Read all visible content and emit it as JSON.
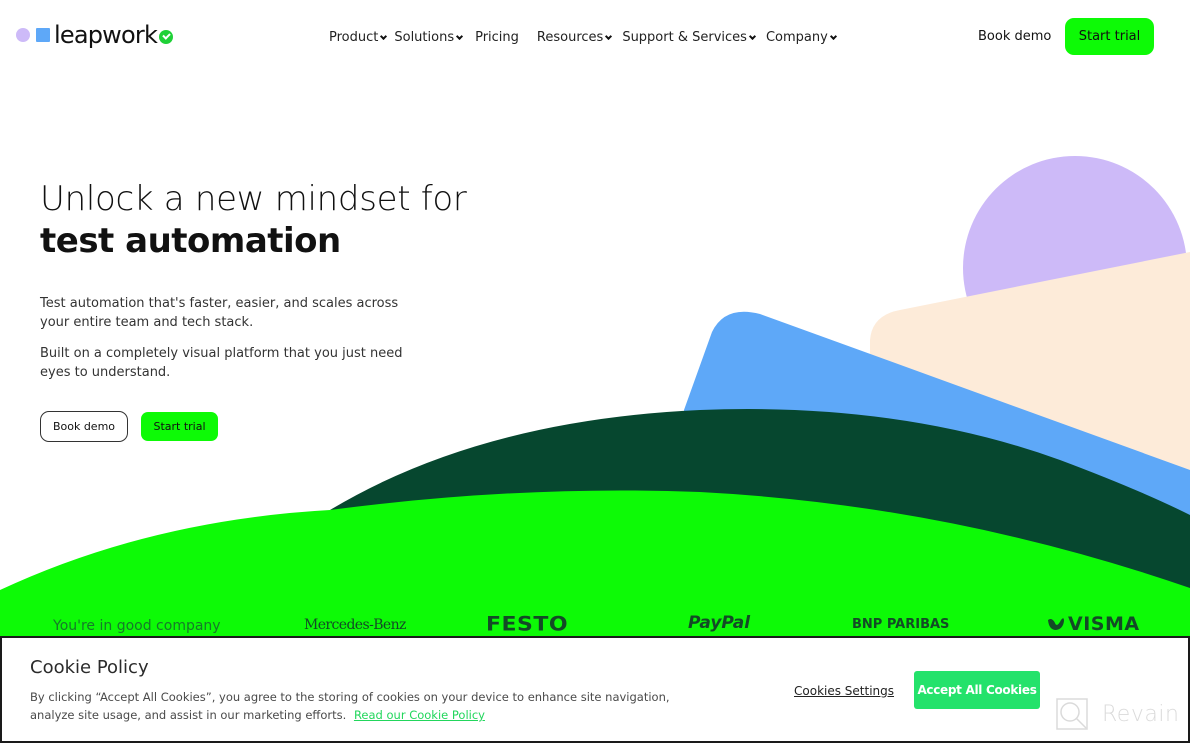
{
  "brand": {
    "name": "leapwork",
    "colors": {
      "green": "#0dfa06",
      "dark_green": "#06472f",
      "blue": "#5ea8f8",
      "lavender": "#cdbaf8",
      "peach": "#fdebd9",
      "accept_green": "#24e26b"
    }
  },
  "header": {
    "nav": [
      {
        "label": "Product",
        "has_dropdown": true
      },
      {
        "label": "Solutions",
        "has_dropdown": true
      },
      {
        "label": "Pricing",
        "has_dropdown": false
      },
      {
        "label": "Resources",
        "has_dropdown": true
      },
      {
        "label": "Support & Services",
        "has_dropdown": true
      },
      {
        "label": "Company",
        "has_dropdown": true
      }
    ],
    "book_demo": "Book demo",
    "start_trial": "Start trial"
  },
  "hero": {
    "title_line1": "Unlock a new mindset for",
    "title_line2": "test automation",
    "paragraph1": "Test automation that's faster, easier, and scales across your entire team and tech stack.",
    "paragraph2": "Built on a completely visual platform that you just need eyes to understand.",
    "book_demo": "Book demo",
    "start_trial": "Start trial"
  },
  "clients": {
    "label": "You're in good company",
    "logos": [
      "Mercedes-Benz",
      "FESTO",
      "PayPal",
      "BNP PARIBAS",
      "VISMA"
    ]
  },
  "cookie_banner": {
    "title": "Cookie Policy",
    "text": "By clicking “Accept All Cookies”, you agree to the storing of cookies on your device to enhance site navigation, analyze site usage, and assist in our marketing efforts.",
    "link": "Read our Cookie Policy",
    "settings_label": "Cookies Settings",
    "accept_label": "Accept All Cookies"
  },
  "watermark": {
    "text": "Revain"
  }
}
